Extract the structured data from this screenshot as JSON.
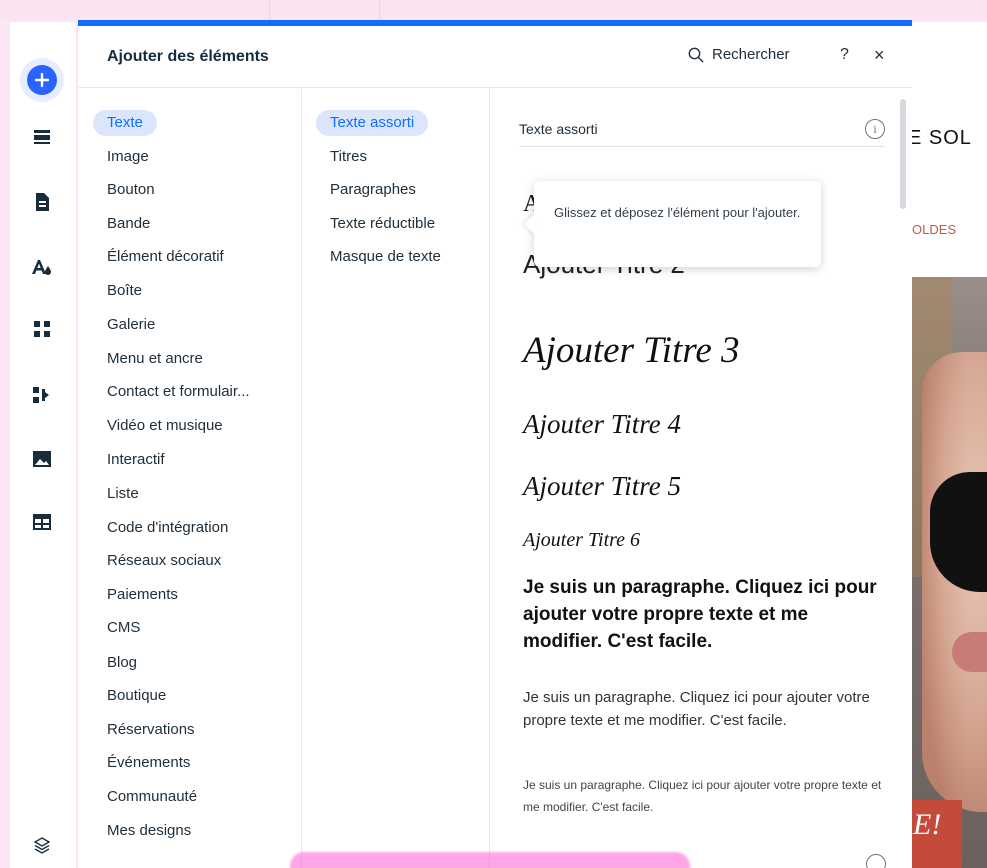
{
  "panel": {
    "title": "Ajouter des éléments",
    "search_label": "Rechercher",
    "help_label": "?",
    "close_label": "×"
  },
  "categories": [
    {
      "label": "Texte",
      "active": true
    },
    {
      "label": "Image"
    },
    {
      "label": "Bouton"
    },
    {
      "label": "Bande"
    },
    {
      "label": "Élément décoratif"
    },
    {
      "label": "Boîte"
    },
    {
      "label": "Galerie"
    },
    {
      "label": "Menu et ancre"
    },
    {
      "label": "Contact et formulair..."
    },
    {
      "label": "Vidéo et musique"
    },
    {
      "label": "Interactif"
    },
    {
      "label": "Liste"
    },
    {
      "label": "Code d'intégration"
    },
    {
      "label": "Réseaux sociaux"
    },
    {
      "label": "Paiements"
    },
    {
      "label": "CMS"
    },
    {
      "label": "Blog"
    },
    {
      "label": "Boutique"
    },
    {
      "label": "Réservations"
    },
    {
      "label": "Événements"
    },
    {
      "label": "Communauté"
    },
    {
      "label": "Mes designs"
    }
  ],
  "subcategories": [
    {
      "label": "Texte assorti",
      "active": true
    },
    {
      "label": "Titres"
    },
    {
      "label": "Paragraphes"
    },
    {
      "label": "Texte réductible"
    },
    {
      "label": "Masque de texte"
    }
  ],
  "content": {
    "section_title": "Texte assorti",
    "info_glyph": "i",
    "title1_partial": "A",
    "title2": "Ajouter Titre 2",
    "title3": "Ajouter Titre 3",
    "title4": "Ajouter Titre 4",
    "title5": "Ajouter Titre 5",
    "title6": "Ajouter Titre 6",
    "paragraph_bold": "Je suis un paragraphe. Cliquez ici pour ajouter votre propre texte et me modifier. C'est facile.",
    "paragraph_regular": "Je suis un paragraphe. Cliquez ici pour ajouter votre propre texte et me modifier. C'est facile.",
    "paragraph_small": "Je suis un paragraphe. Cliquez ici pour ajouter votre propre texte et me modifier. C'est facile."
  },
  "tooltip": {
    "text": "Glissez et déposez l'élément pour l'ajouter."
  },
  "canvas": {
    "brand_text": "E SOL",
    "menu_text": "OLDES",
    "banner_text": "E!"
  },
  "colors": {
    "accent": "#116dff",
    "active_bg": "#dbe6fd",
    "background": "#fbe6f3"
  }
}
